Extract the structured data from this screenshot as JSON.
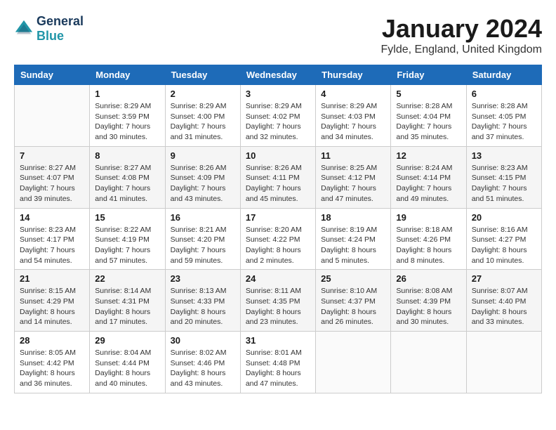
{
  "logo": {
    "line1": "General",
    "line2": "Blue"
  },
  "title": "January 2024",
  "subtitle": "Fylde, England, United Kingdom",
  "header": {
    "days": [
      "Sunday",
      "Monday",
      "Tuesday",
      "Wednesday",
      "Thursday",
      "Friday",
      "Saturday"
    ]
  },
  "weeks": [
    [
      {
        "day": "",
        "sunrise": "",
        "sunset": "",
        "daylight": ""
      },
      {
        "day": "1",
        "sunrise": "Sunrise: 8:29 AM",
        "sunset": "Sunset: 3:59 PM",
        "daylight": "Daylight: 7 hours and 30 minutes."
      },
      {
        "day": "2",
        "sunrise": "Sunrise: 8:29 AM",
        "sunset": "Sunset: 4:00 PM",
        "daylight": "Daylight: 7 hours and 31 minutes."
      },
      {
        "day": "3",
        "sunrise": "Sunrise: 8:29 AM",
        "sunset": "Sunset: 4:02 PM",
        "daylight": "Daylight: 7 hours and 32 minutes."
      },
      {
        "day": "4",
        "sunrise": "Sunrise: 8:29 AM",
        "sunset": "Sunset: 4:03 PM",
        "daylight": "Daylight: 7 hours and 34 minutes."
      },
      {
        "day": "5",
        "sunrise": "Sunrise: 8:28 AM",
        "sunset": "Sunset: 4:04 PM",
        "daylight": "Daylight: 7 hours and 35 minutes."
      },
      {
        "day": "6",
        "sunrise": "Sunrise: 8:28 AM",
        "sunset": "Sunset: 4:05 PM",
        "daylight": "Daylight: 7 hours and 37 minutes."
      }
    ],
    [
      {
        "day": "7",
        "sunrise": "Sunrise: 8:27 AM",
        "sunset": "Sunset: 4:07 PM",
        "daylight": "Daylight: 7 hours and 39 minutes."
      },
      {
        "day": "8",
        "sunrise": "Sunrise: 8:27 AM",
        "sunset": "Sunset: 4:08 PM",
        "daylight": "Daylight: 7 hours and 41 minutes."
      },
      {
        "day": "9",
        "sunrise": "Sunrise: 8:26 AM",
        "sunset": "Sunset: 4:09 PM",
        "daylight": "Daylight: 7 hours and 43 minutes."
      },
      {
        "day": "10",
        "sunrise": "Sunrise: 8:26 AM",
        "sunset": "Sunset: 4:11 PM",
        "daylight": "Daylight: 7 hours and 45 minutes."
      },
      {
        "day": "11",
        "sunrise": "Sunrise: 8:25 AM",
        "sunset": "Sunset: 4:12 PM",
        "daylight": "Daylight: 7 hours and 47 minutes."
      },
      {
        "day": "12",
        "sunrise": "Sunrise: 8:24 AM",
        "sunset": "Sunset: 4:14 PM",
        "daylight": "Daylight: 7 hours and 49 minutes."
      },
      {
        "day": "13",
        "sunrise": "Sunrise: 8:23 AM",
        "sunset": "Sunset: 4:15 PM",
        "daylight": "Daylight: 7 hours and 51 minutes."
      }
    ],
    [
      {
        "day": "14",
        "sunrise": "Sunrise: 8:23 AM",
        "sunset": "Sunset: 4:17 PM",
        "daylight": "Daylight: 7 hours and 54 minutes."
      },
      {
        "day": "15",
        "sunrise": "Sunrise: 8:22 AM",
        "sunset": "Sunset: 4:19 PM",
        "daylight": "Daylight: 7 hours and 57 minutes."
      },
      {
        "day": "16",
        "sunrise": "Sunrise: 8:21 AM",
        "sunset": "Sunset: 4:20 PM",
        "daylight": "Daylight: 7 hours and 59 minutes."
      },
      {
        "day": "17",
        "sunrise": "Sunrise: 8:20 AM",
        "sunset": "Sunset: 4:22 PM",
        "daylight": "Daylight: 8 hours and 2 minutes."
      },
      {
        "day": "18",
        "sunrise": "Sunrise: 8:19 AM",
        "sunset": "Sunset: 4:24 PM",
        "daylight": "Daylight: 8 hours and 5 minutes."
      },
      {
        "day": "19",
        "sunrise": "Sunrise: 8:18 AM",
        "sunset": "Sunset: 4:26 PM",
        "daylight": "Daylight: 8 hours and 8 minutes."
      },
      {
        "day": "20",
        "sunrise": "Sunrise: 8:16 AM",
        "sunset": "Sunset: 4:27 PM",
        "daylight": "Daylight: 8 hours and 10 minutes."
      }
    ],
    [
      {
        "day": "21",
        "sunrise": "Sunrise: 8:15 AM",
        "sunset": "Sunset: 4:29 PM",
        "daylight": "Daylight: 8 hours and 14 minutes."
      },
      {
        "day": "22",
        "sunrise": "Sunrise: 8:14 AM",
        "sunset": "Sunset: 4:31 PM",
        "daylight": "Daylight: 8 hours and 17 minutes."
      },
      {
        "day": "23",
        "sunrise": "Sunrise: 8:13 AM",
        "sunset": "Sunset: 4:33 PM",
        "daylight": "Daylight: 8 hours and 20 minutes."
      },
      {
        "day": "24",
        "sunrise": "Sunrise: 8:11 AM",
        "sunset": "Sunset: 4:35 PM",
        "daylight": "Daylight: 8 hours and 23 minutes."
      },
      {
        "day": "25",
        "sunrise": "Sunrise: 8:10 AM",
        "sunset": "Sunset: 4:37 PM",
        "daylight": "Daylight: 8 hours and 26 minutes."
      },
      {
        "day": "26",
        "sunrise": "Sunrise: 8:08 AM",
        "sunset": "Sunset: 4:39 PM",
        "daylight": "Daylight: 8 hours and 30 minutes."
      },
      {
        "day": "27",
        "sunrise": "Sunrise: 8:07 AM",
        "sunset": "Sunset: 4:40 PM",
        "daylight": "Daylight: 8 hours and 33 minutes."
      }
    ],
    [
      {
        "day": "28",
        "sunrise": "Sunrise: 8:05 AM",
        "sunset": "Sunset: 4:42 PM",
        "daylight": "Daylight: 8 hours and 36 minutes."
      },
      {
        "day": "29",
        "sunrise": "Sunrise: 8:04 AM",
        "sunset": "Sunset: 4:44 PM",
        "daylight": "Daylight: 8 hours and 40 minutes."
      },
      {
        "day": "30",
        "sunrise": "Sunrise: 8:02 AM",
        "sunset": "Sunset: 4:46 PM",
        "daylight": "Daylight: 8 hours and 43 minutes."
      },
      {
        "day": "31",
        "sunrise": "Sunrise: 8:01 AM",
        "sunset": "Sunset: 4:48 PM",
        "daylight": "Daylight: 8 hours and 47 minutes."
      },
      {
        "day": "",
        "sunrise": "",
        "sunset": "",
        "daylight": ""
      },
      {
        "day": "",
        "sunrise": "",
        "sunset": "",
        "daylight": ""
      },
      {
        "day": "",
        "sunrise": "",
        "sunset": "",
        "daylight": ""
      }
    ]
  ]
}
